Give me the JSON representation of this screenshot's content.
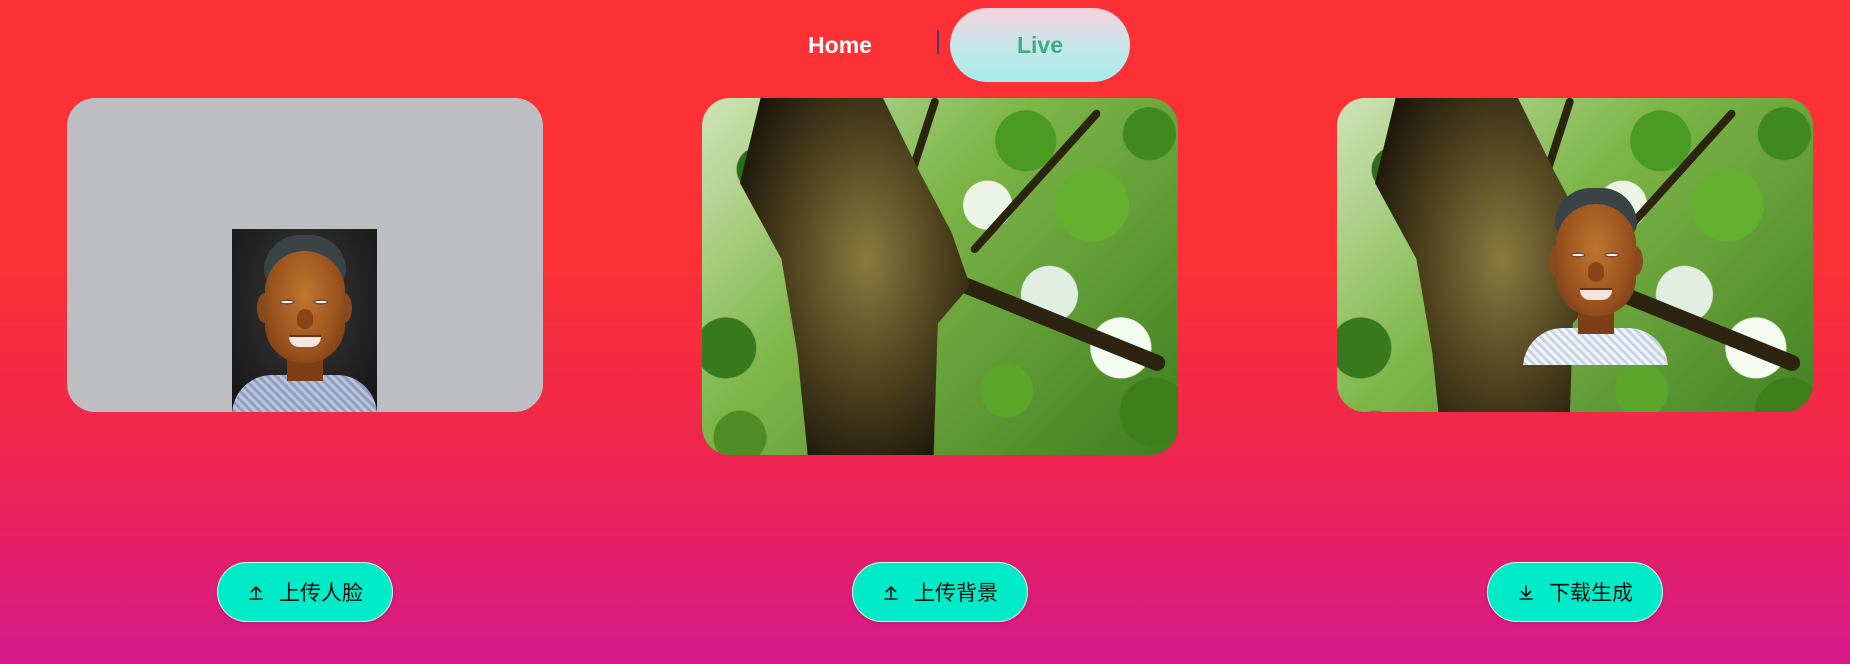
{
  "nav": {
    "home_label": "Home",
    "separator": "|",
    "live_label": "Live",
    "active": "Live"
  },
  "panels": {
    "face": {
      "content": "uploaded-face-photo"
    },
    "background": {
      "content": "tree-background-photo"
    },
    "result": {
      "content": "face-swapped-result-photo"
    }
  },
  "actions": {
    "upload_face": {
      "label": "上传人脸",
      "icon": "upload-icon"
    },
    "upload_background": {
      "label": "上传背景",
      "icon": "upload-icon"
    },
    "download_result": {
      "label": "下载生成",
      "icon": "download-icon"
    }
  },
  "colors": {
    "bg_top": "#fc3035",
    "bg_bottom": "#d6198a",
    "button_accent": "#00ecc8",
    "live_text": "#3fae7b"
  }
}
